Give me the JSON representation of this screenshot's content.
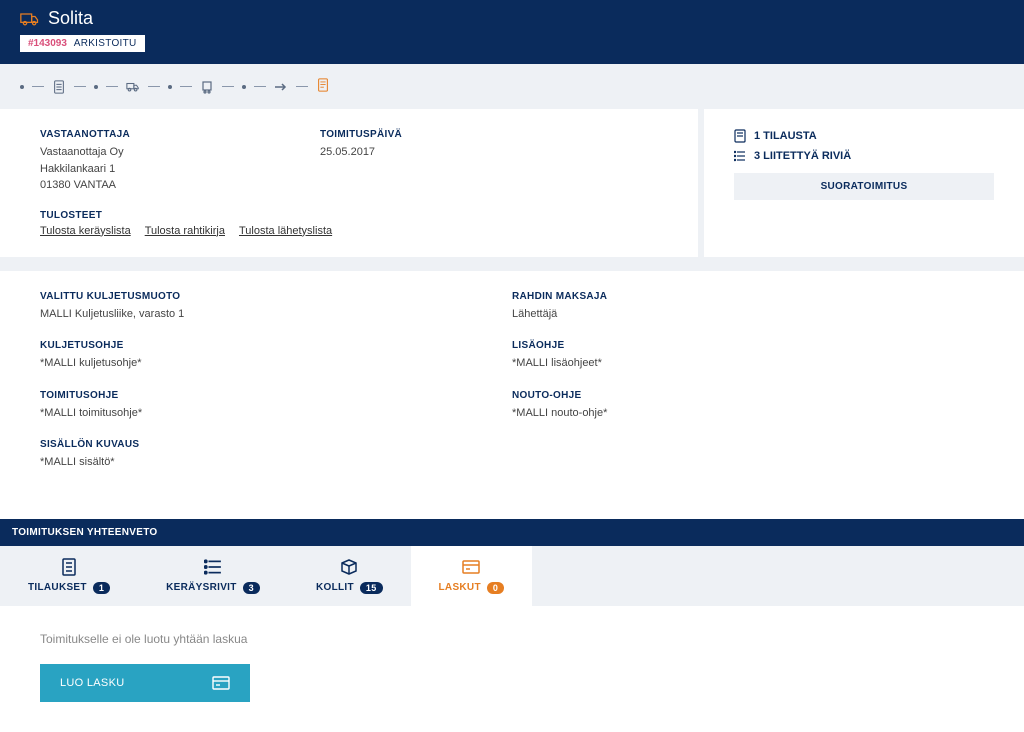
{
  "header": {
    "title": "Solita",
    "id": "#143093",
    "status": "ARKISTOITU"
  },
  "recipient": {
    "label": "VASTAANOTTAJA",
    "name": "Vastaanottaja Oy",
    "address1": "Hakkilankaari 1",
    "address2": "01380 VANTAA"
  },
  "delivery_date": {
    "label": "TOIMITUSPÄIVÄ",
    "value": "25.05.2017"
  },
  "prints": {
    "label": "TULOSTEET",
    "links": [
      "Tulosta keräyslista",
      "Tulosta rahtikirja",
      "Tulosta lähetyslista"
    ]
  },
  "right": {
    "orders": "1 TILAUSTA",
    "rows": "3 LIITETTYÄ RIVIÄ",
    "direct": "SUORATOIMITUS"
  },
  "details": {
    "transport_mode": {
      "label": "VALITTU KULJETUSMUOTO",
      "value": "MALLI Kuljetusliike, varasto 1"
    },
    "freight_payer": {
      "label": "RAHDIN MAKSAJA",
      "value": "Lähettäjä"
    },
    "transport_note": {
      "label": "KULJETUSOHJE",
      "value": "*MALLI kuljetusohje*"
    },
    "extra_note": {
      "label": "LISÄOHJE",
      "value": "*MALLI lisäohjeet*"
    },
    "delivery_note": {
      "label": "TOIMITUSOHJE",
      "value": "*MALLI toimitusohje*"
    },
    "pickup_note": {
      "label": "NOUTO-OHJE",
      "value": "*MALLI nouto-ohje*"
    },
    "content_desc": {
      "label": "SISÄLLÖN KUVAUS",
      "value": "*MALLI sisältö*"
    }
  },
  "summary": {
    "header": "TOIMITUKSEN YHTEENVETO",
    "tabs": [
      {
        "label": "TILAUKSET",
        "count": "1"
      },
      {
        "label": "KERÄYSRIVIT",
        "count": "3"
      },
      {
        "label": "KOLLIT",
        "count": "15"
      },
      {
        "label": "LASKUT",
        "count": "0"
      }
    ],
    "empty_msg": "Toimitukselle ei ole luotu yhtään laskua",
    "create_btn": "LUO LASKU"
  }
}
